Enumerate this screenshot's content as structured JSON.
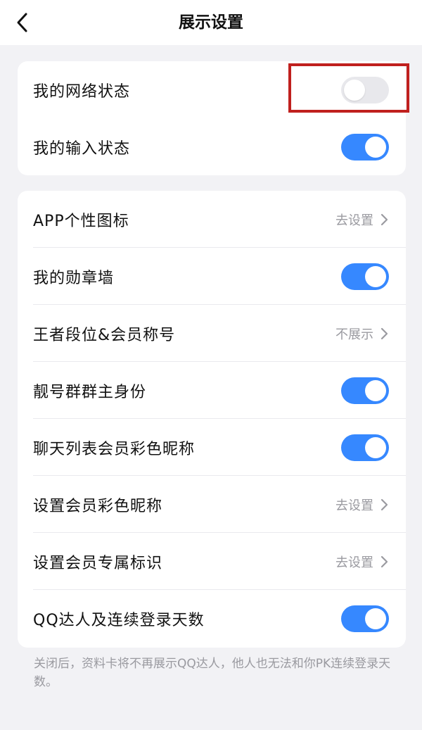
{
  "header": {
    "title": "展示设置"
  },
  "group1": {
    "items": [
      {
        "label": "我的网络状态",
        "toggle_on": false
      },
      {
        "label": "我的输入状态",
        "toggle_on": true
      }
    ]
  },
  "group2": {
    "items": [
      {
        "label": "APP个性图标",
        "value": "去设置"
      },
      {
        "label": "我的勋章墙",
        "toggle_on": true
      },
      {
        "label": "王者段位&会员称号",
        "value": "不展示"
      },
      {
        "label": "靓号群群主身份",
        "toggle_on": true
      },
      {
        "label": "聊天列表会员彩色昵称",
        "toggle_on": true
      },
      {
        "label": "设置会员彩色昵称",
        "value": "去设置"
      },
      {
        "label": "设置会员专属标识",
        "value": "去设置"
      },
      {
        "label": "QQ达人及连续登录天数",
        "toggle_on": true
      }
    ]
  },
  "footnote": "关闭后，资料卡将不再展示QQ达人，他人也无法和你PK连续登录天数。",
  "colors": {
    "accent": "#3688ff",
    "toggle_off": "#e8e8ec",
    "highlight": "#c0201e"
  }
}
